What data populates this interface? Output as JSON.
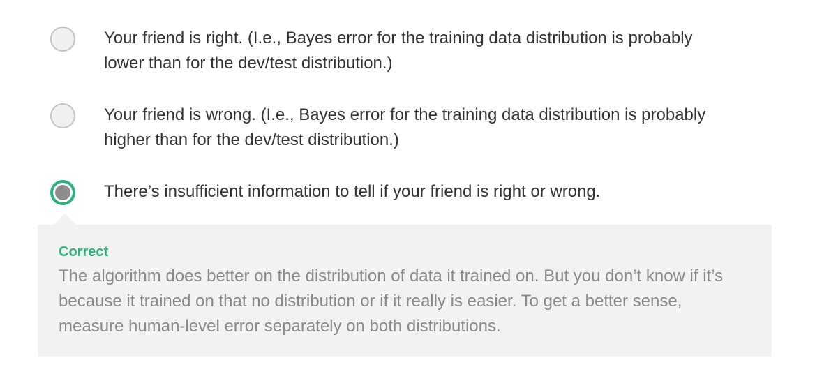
{
  "options": [
    {
      "text": "Your friend is right. (I.e., Bayes error for the training data distribution is probably lower than for the dev/test distribution.)",
      "selected": false
    },
    {
      "text": "Your friend is wrong. (I.e., Bayes error for the training data distribution is probably higher than for the dev/test distribution.)",
      "selected": false
    },
    {
      "text": "There’s insufficient information to tell if your friend is right or wrong.",
      "selected": true
    }
  ],
  "feedback": {
    "status": "Correct",
    "explanation": "The algorithm does better on the distribution of data it trained on. But you don’t know if it’s because it trained on that no distribution or if it really is easier. To get a better sense, measure human-level error separately on both distributions.",
    "status_color": "#2ab27b"
  },
  "colors": {
    "selected_ring": "#2ab27b",
    "selected_dot": "#8c8c8c",
    "feedback_bg": "#f2f2f2"
  }
}
